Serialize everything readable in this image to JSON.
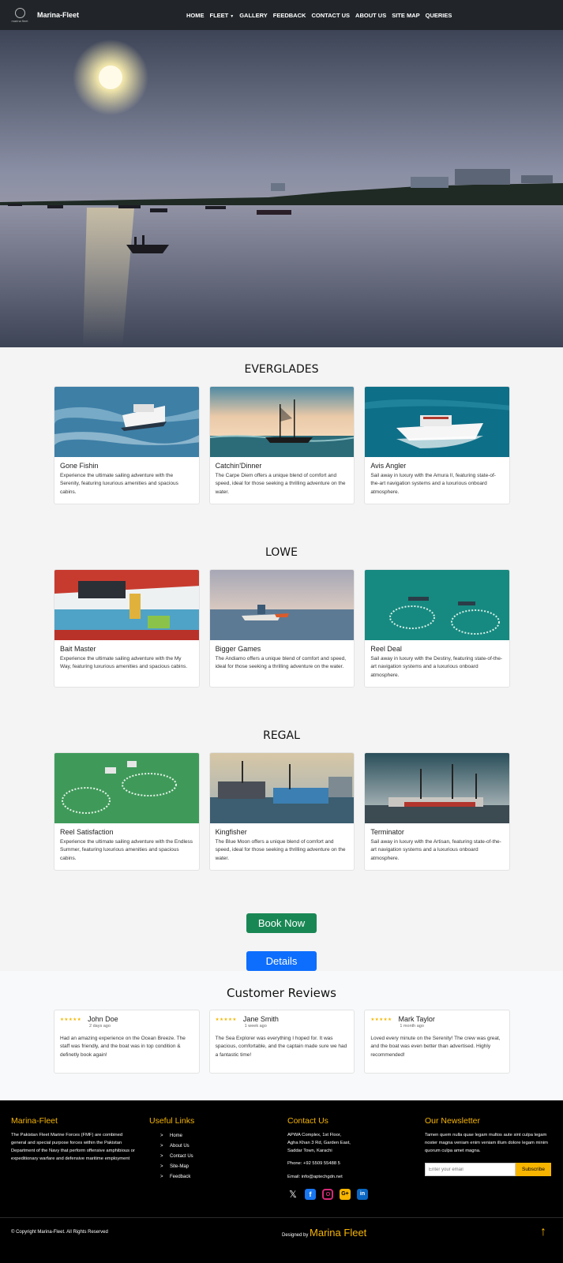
{
  "nav": {
    "brand": "Marina-Fleet",
    "logo_caption": "marina fleet",
    "items": [
      "HOME",
      "FLEET",
      "GALLERY",
      "FEEDBACK",
      "CONTACT US",
      "ABOUT US",
      "SITE MAP",
      "QUERIES"
    ]
  },
  "sections": [
    {
      "title": "EVERGLADES",
      "cards": [
        {
          "title": "Gone Fishin",
          "text": "Experience the ultimate sailing adventure with the Serenity, featuring luxurious amenities and spacious cabins."
        },
        {
          "title": "Catchin'Dinner",
          "text": "The Carpe Diem offers a unique blend of comfort and speed, ideal for those seeking a thrilling adventure on the water."
        },
        {
          "title": "Avis Angler",
          "text": "Sail away in luxury with the Amura II, featuring state-of-the-art navigation systems and a luxurious onboard atmosphere."
        }
      ]
    },
    {
      "title": "LOWE",
      "cards": [
        {
          "title": "Bait Master",
          "text": "Experience the ultimate sailing adventure with the My Way, featuring luxurious amenities and spacious cabins."
        },
        {
          "title": "Bigger Games",
          "text": "The Andiamo offers a unique blend of comfort and speed, ideal for those seeking a thrilling adventure on the water."
        },
        {
          "title": "Reel Deal",
          "text": "Sail away in luxury with the Destiny, featuring state-of-the-art navigation systems and a luxurious onboard atmosphere."
        }
      ]
    },
    {
      "title": "REGAL",
      "cards": [
        {
          "title": "Reel Satisfaction",
          "text": "Experience the ultimate sailing adventure with the Endless Summer, featuring luxurious amenities and spacious cabins."
        },
        {
          "title": "Kingfisher",
          "text": "The Blue Moon offers a unique blend of comfort and speed, ideal for those seeking a thrilling adventure on the water."
        },
        {
          "title": "Terminator",
          "text": "Sail away in luxury with the Artisan, featuring state-of-the-art navigation systems and a luxurious onboard atmosphere."
        }
      ]
    }
  ],
  "buttons": {
    "book": "Book Now",
    "details": "Details"
  },
  "reviews": {
    "title": "Customer Reviews",
    "stars": "★★★★★",
    "items": [
      {
        "name": "John Doe",
        "time": "2 days ago",
        "text": "Had an amazing experience on the Ocean Breeze. The staff was friendly, and the boat was in top condition & definetly book again!"
      },
      {
        "name": "Jane Smith",
        "time": "1 week ago",
        "text": "The Sea Explorer was everything I hoped for. It was spacious, comfortable, and the captain made sure we had a fantastic time!"
      },
      {
        "name": "Mark Taylor",
        "time": "1 month ago",
        "text": "Loved every minute on the Serenity! The crew was great, and the boat was even better than advertised. Highly recommended!"
      }
    ]
  },
  "footer": {
    "about": {
      "title": "Marina-Fleet",
      "text": "The Pakistan Fleet Marine Forces (FMF) are combined general and special purpose forces within the Pakistan Department of the Navy that perform offensive amphibious or expeditionary warfare and defensive maritime employment"
    },
    "links": {
      "title": "Useful Links",
      "items": [
        "Home",
        "About Us",
        "Contact Us",
        "Site-Map",
        "Feedback"
      ]
    },
    "contact": {
      "title": "Contact Us",
      "address1": "APWA Complex, 1st Floor,",
      "address2": "Agha Khan 3 Rd, Garden East,",
      "address3": "Saddar Town, Karachi",
      "phone": "Phone: +92 5509 55488 5",
      "email": "Email: info@aptechgdn.net"
    },
    "newsletter": {
      "title": "Our Newsletter",
      "text": "Tamen quem nulla quae legam multos aute sint culpa legam noster magna veniam enim veniam illum dolore legam minim quorum culpa amet magna.",
      "placeholder": "Enter your email",
      "button": "Subscribe"
    },
    "copyright": "© Copyright Marina-Fleet. All Rights Reserved",
    "designed_by": "Designed by",
    "designer": "Marina Fleet",
    "to_top": "↑"
  },
  "colors": {
    "accent": "#f7b500",
    "book": "#198754",
    "details": "#0d6efd",
    "nav": "#212529"
  }
}
